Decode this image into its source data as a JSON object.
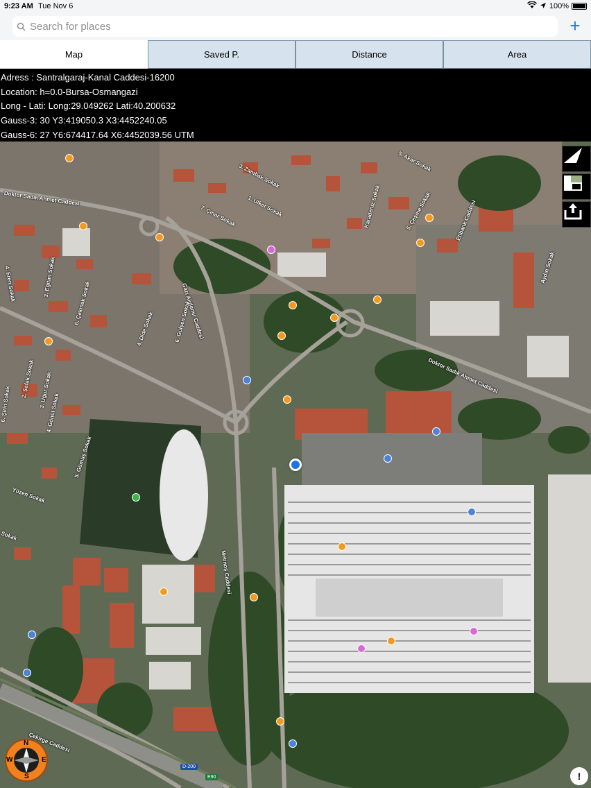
{
  "status": {
    "time": "9:23 AM",
    "date": "Tue Nov 6",
    "battery": "100%"
  },
  "search": {
    "placeholder": "Search for places",
    "add_label": "+"
  },
  "tabs": [
    {
      "label": "Map",
      "active": true
    },
    {
      "label": "Saved P.",
      "active": false
    },
    {
      "label": "Distance",
      "active": false
    },
    {
      "label": "Area",
      "active": false
    }
  ],
  "info": {
    "address": "Adress   : Santralgaraj-Kanal Caddesi-16200",
    "location": "Location: h=0.0-Bursa-Osmangazi",
    "longlat": "Long - Lati: Long:29.049262 Lati:40.200632",
    "gauss3": "Gauss-3: 30 Y3:419050.3 X3:4452240.05",
    "gauss6": "Gauss-6: 27 Y6:674417.64 X6:4452039.56 UTM"
  },
  "map": {
    "streets": [
      "3. Zambak Sokak",
      "5. Akar Sokak",
      "Doktor Sadık Ahmet Caddesi",
      "1. Ülker Sokak",
      "7. Çınar Sokak",
      "Karadeniz Sokak",
      "5. Çeşme Sokak",
      "Etibank Caddesi",
      "4. Eren Sokak",
      "Gazi Akdemir Caddesi",
      "3. Eğitim Sokak",
      "6. Çakmak Sokak",
      "4. Dide Sokak",
      "6. Gülşen Sokak",
      "Doktor Sadık Ahmet Caddesi",
      "Aydın Sokak",
      "2. Şafak Sokak",
      "3. Uğur Sokak",
      "6. Şirin Sokak",
      "4. Gönül Sokak",
      "5. Gümüş Sokak",
      "Yüzen Sokak",
      "Sokak",
      "Metinoş Caddesi",
      "Çekirge Caddesi"
    ],
    "route_shields": [
      "D-200",
      "E90"
    ]
  },
  "compass": {
    "n": "N",
    "s": "S",
    "w": "W",
    "e": "E"
  },
  "info_button": "!",
  "colors": {
    "tab_bg": "#d6e3ee",
    "accent": "#1f7bd8",
    "user_location": "#1a73e8"
  }
}
